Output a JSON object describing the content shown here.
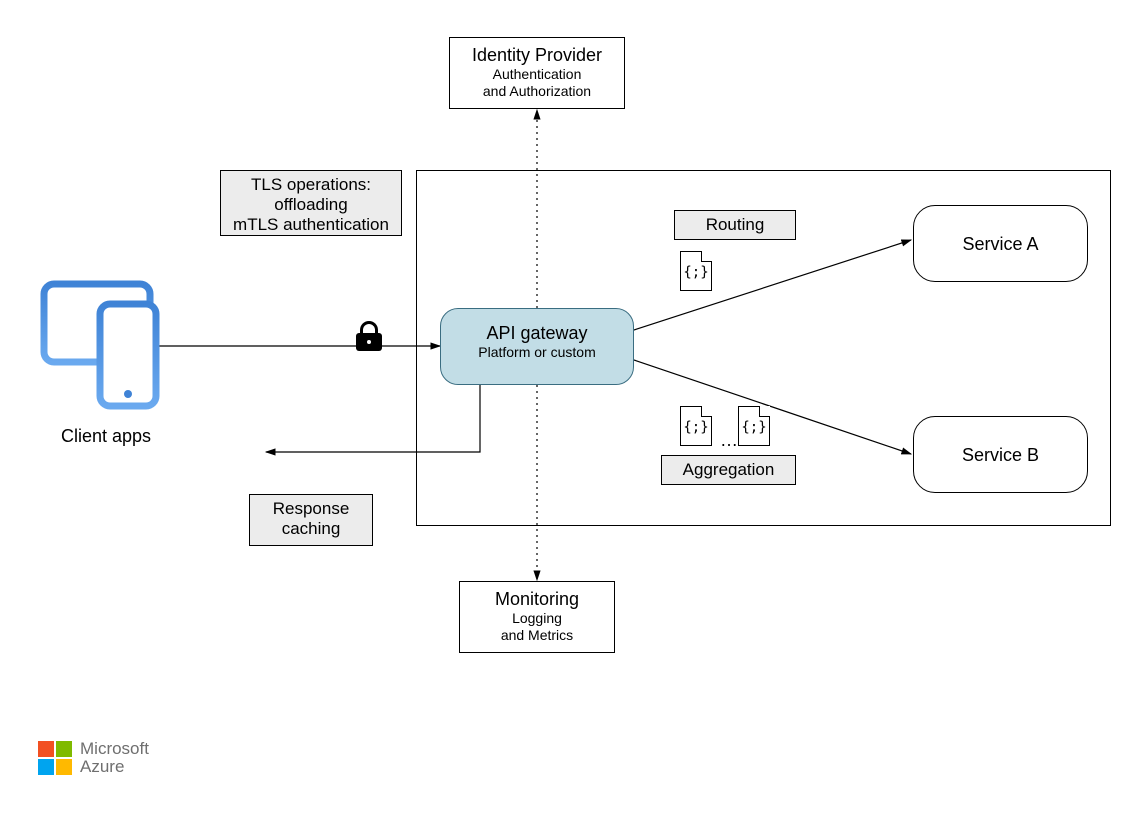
{
  "identity_provider": {
    "title": "Identity Provider",
    "sub1": "Authentication",
    "sub2": "and Authorization"
  },
  "tls_box": {
    "line1": "TLS operations:",
    "line2": "offloading",
    "line3": "mTLS authentication"
  },
  "client_label": "Client apps",
  "gateway": {
    "title": "API gateway",
    "sub": "Platform or custom"
  },
  "routing_label": "Routing",
  "aggregation_label": "Aggregation",
  "service_a": "Service A",
  "service_b": "Service B",
  "response_caching": {
    "line1": "Response",
    "line2": "caching"
  },
  "monitoring": {
    "title": "Monitoring",
    "sub1": "Logging",
    "sub2": "and Metrics"
  },
  "file_glyph": "{;}",
  "ellipsis": "…",
  "azure": {
    "line1": "Microsoft",
    "line2": "Azure"
  },
  "icons": {
    "lock": "lock-icon",
    "file": "file-icon",
    "tablet": "tablet-icon",
    "phone": "phone-icon",
    "azure_logo": "azure-logo-icon"
  }
}
